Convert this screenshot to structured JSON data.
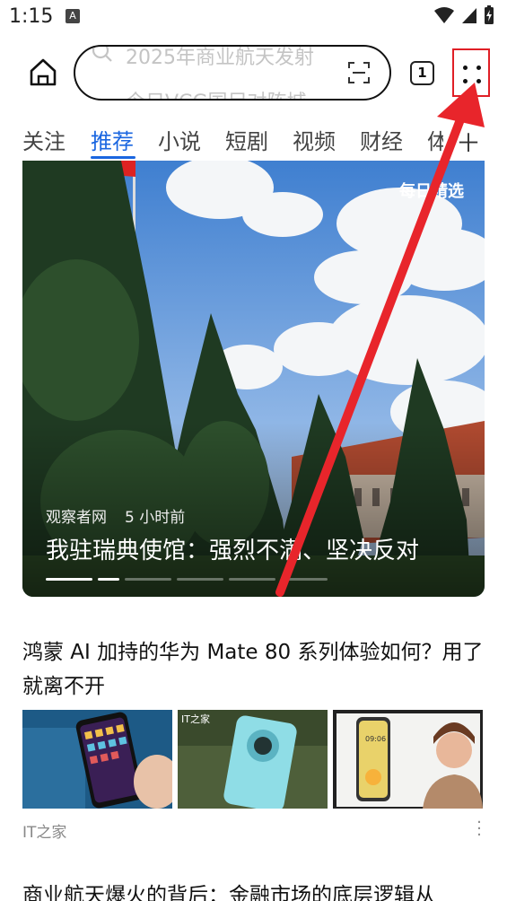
{
  "status": {
    "time": "1:15",
    "notification_glyph": "A"
  },
  "header": {
    "search_line1": "2025年商业航天发射",
    "search_line2": "今日VCG国足对阵城"
  },
  "tab_count": "1",
  "categories": [
    "关注",
    "推荐",
    "小说",
    "短剧",
    "视频",
    "财经",
    "体"
  ],
  "active_category": "推荐",
  "hero": {
    "badge": "每日精选",
    "source": "观察者网",
    "time": "5 小时前",
    "title": "我驻瑞典使馆：强烈不满、坚决反对"
  },
  "article1": {
    "title": "鸿蒙 AI 加持的华为 Mate 80 系列体验如何？用了就离不开",
    "source": "IT之家",
    "thumb2_label": "IT之家",
    "thumb3_label": "09:06"
  },
  "article2": {
    "title": "商业航天爆火的背后：金融市场的底层逻辑从"
  },
  "colors": {
    "accent": "#1a66e0",
    "highlight_box": "#e01f26",
    "arrow": "#e8252b"
  },
  "icons": {
    "home": "home-icon",
    "search": "search-icon",
    "scan": "scan-icon",
    "menu": "more-dots-icon"
  }
}
